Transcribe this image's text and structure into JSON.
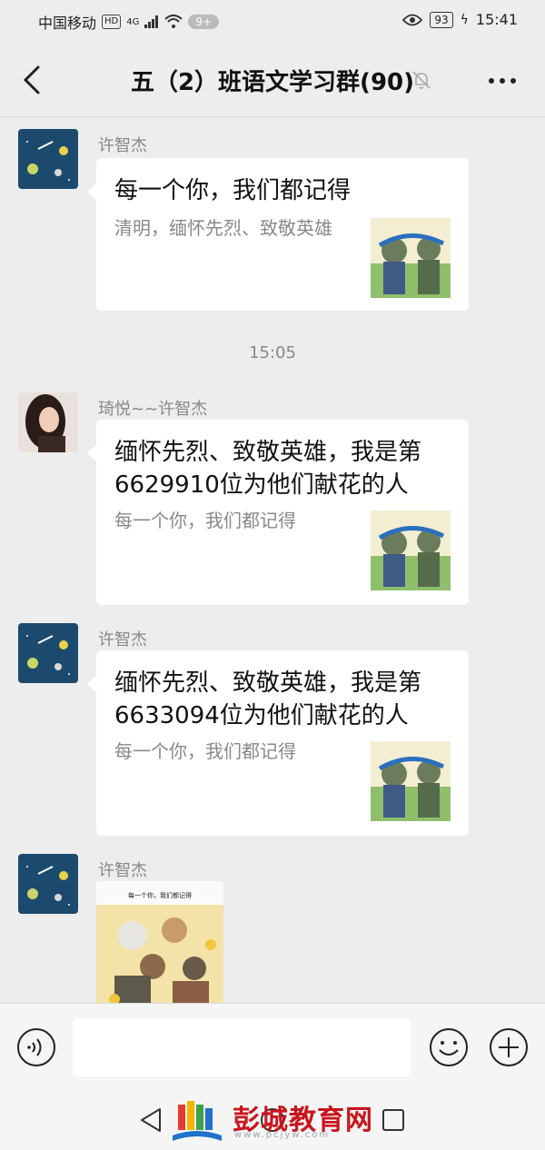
{
  "status_bar": {
    "carrier": "中国移动",
    "hd": "HD",
    "network": "4G",
    "notification_count": "9+",
    "battery": "93",
    "time": "15:41"
  },
  "header": {
    "title": "五（2）班语文学习群(90)"
  },
  "messages": [
    {
      "sender": "许智杰",
      "title": "每一个你，我们都记得",
      "desc": "清明，缅怀先烈、致敬英雄"
    },
    {
      "sender": "琦悦~~许智杰",
      "title": "缅怀先烈、致敬英雄，我是第6629910位为他们献花的人",
      "desc": "每一个你，我们都记得"
    },
    {
      "sender": "许智杰",
      "title": "缅怀先烈、致敬英雄，我是第6633094位为他们献花的人",
      "desc": "每一个你，我们都记得"
    },
    {
      "sender": "许智杰",
      "image_caption": "每一个你，我们都记得"
    }
  ],
  "timestamp": "15:05",
  "input": {
    "placeholder": ""
  },
  "watermark": {
    "name": "彭城教育网",
    "url": "www.pcjyw.com"
  }
}
